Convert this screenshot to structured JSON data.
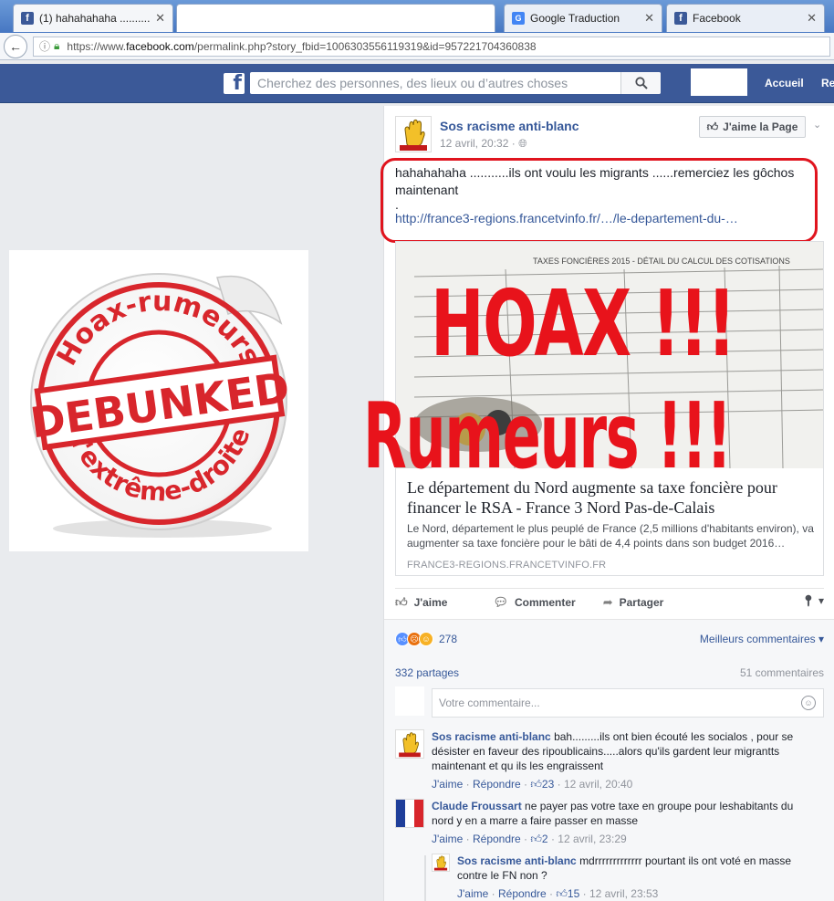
{
  "browser": {
    "tabs": [
      {
        "title": "(1) hahahahaha ...........",
        "icon": "facebook-icon",
        "active": true
      },
      {
        "title": "",
        "icon": "",
        "active": false
      },
      {
        "title": "Google Traduction",
        "icon": "google-translate-icon",
        "active": false
      },
      {
        "title": "Facebook",
        "icon": "facebook-icon",
        "active": false
      }
    ],
    "url_prefix": "https://www.",
    "url_domain": "facebook.com",
    "url_path": "/permalink.php?story_fbid=1006303556119319&id=957221704360838"
  },
  "fb_header": {
    "search_placeholder": "Cherchez des personnes, des lieux ou d’autres choses",
    "nav_home": "Accueil",
    "nav_partial": "Re"
  },
  "post": {
    "author": "Sos racisme anti-blanc",
    "timestamp": "12 avril, 20:32",
    "privacy_icon": "globe-icon",
    "like_page_label": "J'aime la Page",
    "text_line1": "hahahahaha ...........ils ont voulu les migrants ......remerciez les gôchos maintenant",
    "text_dot": ".",
    "text_link": "http://france3-regions.francetvinfo.fr/…/le-departement-du-…",
    "card": {
      "title": "Le département du Nord augmente sa taxe foncière pour financer le RSA - France 3 Nord Pas-de-Calais",
      "description": "Le Nord, département le plus peuplé de France (2,5 millions d'habitants environ), va augmenter sa taxe foncière pour le bâti de 4,4 points dans son budget 2016…",
      "domain": "FRANCE3-REGIONS.FRANCETVINFO.FR",
      "image_header": "TAXES FONCIÈRES 2015 - DÉTAIL DU CALCUL DES COTISATIONS"
    },
    "overlay_hoax": "HOAX !!!",
    "overlay_rumeurs": "Rumeurs !!!",
    "actions": {
      "like": "J'aime",
      "comment": "Commenter",
      "share": "Partager"
    }
  },
  "sticker": {
    "text_top": "Hoax-rumeurs",
    "text_center": "DEBUNKED",
    "text_bottom": "d'extrême-droite"
  },
  "ufi": {
    "reactions_count": "278",
    "sort_label": "Meilleurs commentaires",
    "shares": "332 partages",
    "comments_count": "51 commentaires",
    "comment_placeholder": "Votre commentaire...",
    "comments": [
      {
        "author": "Sos racisme anti-blanc",
        "text": "bah.........ils ont bien écouté les socialos , pour se désister en faveur des ripoublicains.....alors qu'ils gardent leur migrantts maintenant et qu ils les engraissent",
        "like": "J'aime",
        "reply": "Répondre",
        "likes": "23",
        "time": "12 avril, 20:40"
      },
      {
        "author": "Claude Froussart",
        "text": "ne payer pas votre taxe en groupe pour leshabitants du nord y en a marre a faire passer en masse",
        "like": "J'aime",
        "reply": "Répondre",
        "likes": "2",
        "time": "12 avril, 23:29"
      },
      {
        "author": "Sos racisme anti-blanc",
        "text": "mdrrrrrrrrrrrrr pourtant ils ont voté en masse contre le FN non ?",
        "like": "J'aime",
        "reply": "Répondre",
        "likes": "15",
        "time": "12 avril, 23:53"
      }
    ]
  },
  "colors": {
    "fb_blue": "#3b5998",
    "link_blue": "#365899",
    "hoax_red": "#e8131b"
  }
}
